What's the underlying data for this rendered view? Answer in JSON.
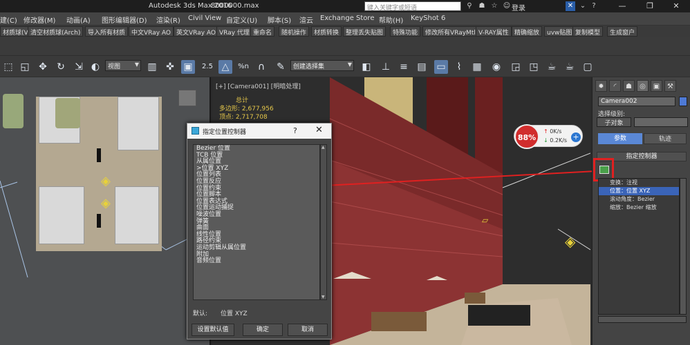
{
  "titlebar": {
    "app_title": "Autodesk 3ds Max 2016",
    "file_name": "8000000.max",
    "search_placeholder": "键入关键字或短语",
    "login_label": "登录",
    "minimize": "—",
    "restore": "❐",
    "close": "✕"
  },
  "menubar": {
    "items": [
      "建(C)",
      "修改器(M)",
      "动画(A)",
      "图形编辑器(D)",
      "渲染(R)",
      "Civil View",
      "自定义(U)",
      "脚本(S)",
      "渲云",
      "Exchange Store",
      "帮助(H)",
      "KeyShot 6"
    ]
  },
  "pluginbar": {
    "items": [
      "材质球(VR)",
      "清空材质球(Arch)",
      "导入所有材质",
      "中文VRay AO",
      "英文VRay AO",
      "VRay 代理",
      "重命名",
      "随机操作",
      "材质转换",
      "整理丢失贴图",
      "特殊功能",
      "修改所有VRayMtl",
      "V-RAY属性",
      "精确缩放",
      "uvw贴图",
      "复制模型",
      "生成窗户"
    ]
  },
  "toolbar": {
    "view_select": "视图",
    "selection_set": "创建选择集",
    "snap_angle": "2.5",
    "percent_snap": "%n"
  },
  "viewport_right": {
    "label": "[+] [Camera001] [明暗处理]",
    "stats_total": "总计",
    "stats_polys_label": "多边形:",
    "stats_polys": "2,677,956",
    "stats_verts_label": "顶点:",
    "stats_verts": "2,717,708"
  },
  "netwidget": {
    "percent": "88%",
    "upload": "0K/s",
    "download": "0.2K/s",
    "plus": "+"
  },
  "command_panel": {
    "camera_name": "Camera002",
    "selection_level_label": "选择级别:",
    "subobject_label": "子对象",
    "params_tab": "参数",
    "tracks_tab": "轨迹",
    "assign_controller_header": "指定控制器",
    "tree": [
      "变换：注视",
      "位置：位置 XYZ",
      "滚动角度：Bezier",
      "缩放：Bezier 缩放"
    ]
  },
  "dialog": {
    "title": "指定位置控制器",
    "help": "?",
    "close": "✕",
    "controllers": [
      "Bezier 位置",
      "TCB 位置",
      "从属位置",
      ">位置 XYZ",
      "位置列表",
      "位置反应",
      "位置约束",
      "位置脚本",
      "位置表达式",
      "位置运动捕捉",
      "噪波位置",
      "弹簧",
      "曲面",
      "线性位置",
      "路径约束",
      "运动剪辑从属位置",
      "附加",
      "音频位置"
    ],
    "default_label": "默认:",
    "default_value": "位置 XYZ",
    "set_default_button": "设置默认值",
    "ok_button": "确定",
    "cancel_button": "取消"
  },
  "colors": {
    "annotation_red": "#e02020",
    "accent_blue": "#5a88d6",
    "selection_blue": "#3a64b8"
  }
}
